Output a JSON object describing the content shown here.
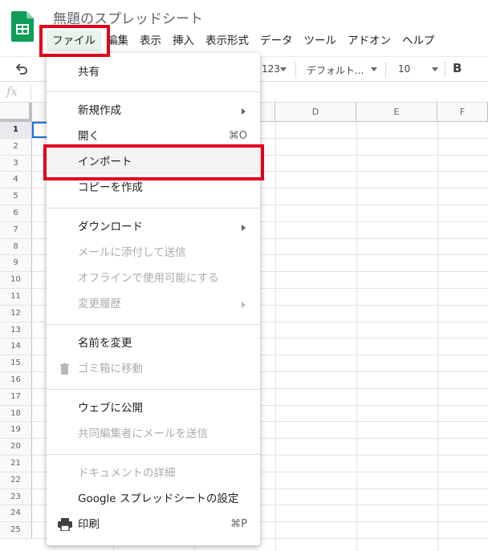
{
  "header": {
    "doc_title": "無題のスプレッドシート",
    "logo": "sheets-logo-icon",
    "brand_color": "#0f9d58"
  },
  "menubar": {
    "items": [
      "ファイル",
      "編集",
      "表示",
      "挿入",
      "表示形式",
      "データ",
      "ツール",
      "アドオン",
      "ヘルプ"
    ],
    "active_index": 0
  },
  "toolbar": {
    "format_123": "123",
    "font": "デフォルト...",
    "font_size": "10",
    "bold": "B"
  },
  "formula_bar": {
    "label": "fx"
  },
  "grid": {
    "columns": [
      "D",
      "E",
      "F"
    ],
    "rows": [
      "1",
      "2",
      "3",
      "4",
      "5",
      "6",
      "7",
      "8",
      "9",
      "10",
      "11",
      "12",
      "13",
      "14",
      "15",
      "16",
      "17",
      "18",
      "19",
      "20",
      "21",
      "22",
      "23",
      "24",
      "25"
    ],
    "selected_row": "1"
  },
  "file_menu": {
    "share": "共有",
    "new": "新規作成",
    "open": "開く",
    "open_shortcut": "⌘O",
    "import": "インポート",
    "copy": "コピーを作成",
    "download": "ダウンロード",
    "email_attach": "メールに添付して送信",
    "offline": "オフラインで使用可能にする",
    "history": "変更履歴",
    "rename": "名前を変更",
    "trash": "ゴミ箱に移動",
    "publish": "ウェブに公開",
    "email_collab": "共同編集者にメールを送信",
    "details": "ドキュメントの詳細",
    "settings": "Google スプレッドシートの設定",
    "print": "印刷",
    "print_shortcut": "⌘P"
  },
  "highlight_color": "#e0001b"
}
